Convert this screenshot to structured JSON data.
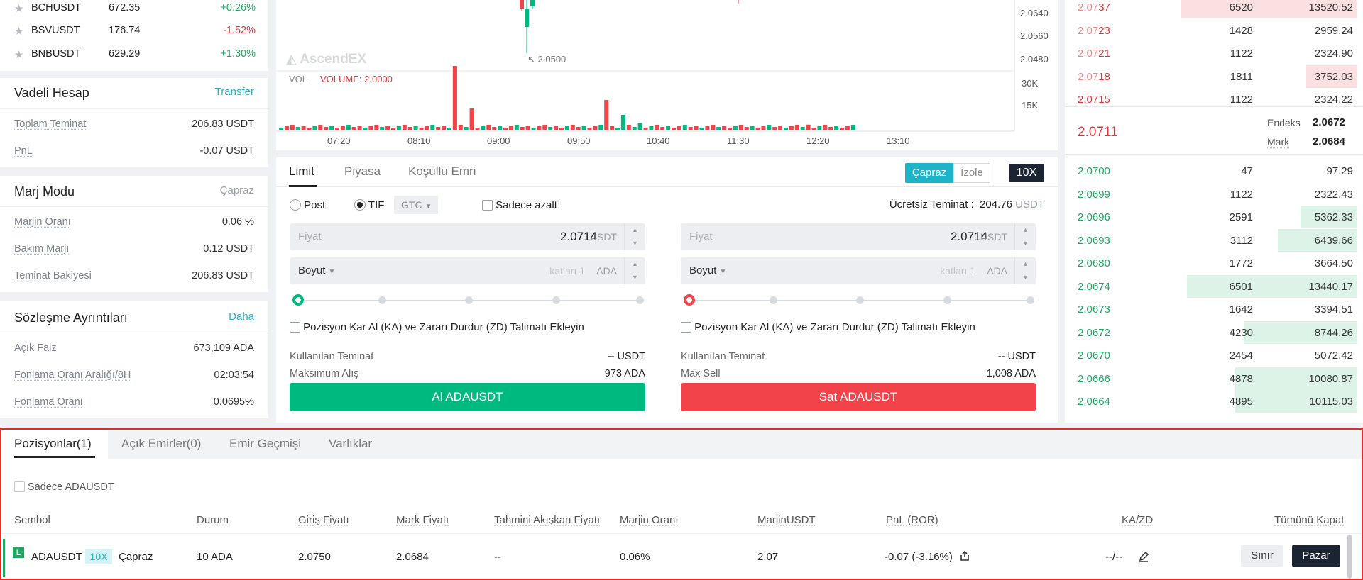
{
  "colors": {
    "green": "#1ea862",
    "red": "#e0353b",
    "teal": "#1fb3c9",
    "buy_button": "#00b97f",
    "sell_button": "#f3434a",
    "panel_border": "#e22a2a"
  },
  "tickers": [
    {
      "symbol": "BCHUSDT",
      "price": "672.35",
      "change": "+0.26%",
      "dir": "up"
    },
    {
      "symbol": "BSVUSDT",
      "price": "176.74",
      "change": "-1.52%",
      "dir": "down"
    },
    {
      "symbol": "BNBUSDT",
      "price": "629.29",
      "change": "+1.30%",
      "dir": "up"
    }
  ],
  "futures_account": {
    "title": "Vadeli Hesap",
    "action": "Transfer",
    "rows": [
      {
        "label": "Toplam Teminat",
        "value": "206.83 USDT"
      },
      {
        "label": "PnL",
        "value": "-0.07 USDT"
      }
    ]
  },
  "margin_mode": {
    "title": "Marj Modu",
    "value": "Çapraz",
    "rows": [
      {
        "label": "Marjin Oranı",
        "value": "0.06 %"
      },
      {
        "label": "Bakım Marjı",
        "value": "0.12 USDT"
      },
      {
        "label": "Teminat Bakiyesi",
        "value": "206.83 USDT"
      }
    ]
  },
  "contract": {
    "title": "Sözleşme Ayrıntıları",
    "action": "Daha",
    "rows": [
      {
        "label": "Açık Faiz",
        "value": "673,109 ADA"
      },
      {
        "label": "Fonlama Oranı Aralığı/8H",
        "value": "02:03:54"
      },
      {
        "label": "Fonlama Oranı",
        "value": "0.0695%"
      }
    ]
  },
  "chart": {
    "price_ticks": [
      "2.0640",
      "2.0560",
      "2.0480"
    ],
    "low_label": "2.0500",
    "watermark": "AscendEX",
    "vol_label": "VOL",
    "volume_label": "VOLUME: 2.0000",
    "vol_ticks": [
      "30K",
      "15K"
    ],
    "time_ticks": [
      "07:20",
      "08:10",
      "09:00",
      "09:50",
      "10:40",
      "11:30",
      "12:20",
      "13:10"
    ]
  },
  "order_form": {
    "tabs": [
      "Limit",
      "Piyasa",
      "Koşullu Emri"
    ],
    "mode_cross": "Çapraz",
    "mode_isolated": "İzole",
    "leverage": "10X",
    "post": "Post",
    "tif": "TIF",
    "tif_value": "GTC",
    "reduce_only": "Sadece azalt",
    "free_margin_label": "Ücretsiz Teminat :",
    "free_margin_value": "204.76",
    "free_margin_unit": "USDT",
    "price_label": "Fiyat",
    "price_value": "2.0714",
    "price_unit": "USDT",
    "size_label": "Boyut",
    "size_placeholder": "katları 1",
    "size_unit": "ADA",
    "tpsl": "Pozisyon Kar Al (KA) ve Zararı Durdur (ZD) Talimatı Ekleyin",
    "buy": {
      "used_label": "Kullanılan Teminat",
      "used_value": "-- USDT",
      "max_label": "Maksimum Alış",
      "max_value": "973 ADA",
      "button": "Al ADAUSDT"
    },
    "sell": {
      "used_label": "Kullanılan Teminat",
      "used_value": "-- USDT",
      "max_label": "Max Sell",
      "max_value": "1,008 ADA",
      "button": "Sat ADAUSDT"
    }
  },
  "orderbook": {
    "asks": [
      {
        "pa": "2.07",
        "pb": "37",
        "qty": "6520",
        "total": "13520.52",
        "depth": 0.62
      },
      {
        "pa": "2.07",
        "pb": "23",
        "qty": "1428",
        "total": "2959.24",
        "depth": 0.0
      },
      {
        "pa": "2.07",
        "pb": "21",
        "qty": "1122",
        "total": "2324.90",
        "depth": 0.0
      },
      {
        "pa": "2.07",
        "pb": "18",
        "qty": "1811",
        "total": "3752.03",
        "depth": 0.18
      },
      {
        "pa": "2.0715",
        "pb": "",
        "qty": "1122",
        "total": "2324.22",
        "depth": 0.0
      }
    ],
    "last_price": "2.0711",
    "index_label": "Endeks",
    "index_value": "2.0672",
    "mark_label": "Mark",
    "mark_value": "2.0684",
    "bids": [
      {
        "pa": "2.0700",
        "pb": "",
        "qty": "47",
        "total": "97.29",
        "depth": 0.0
      },
      {
        "pa": "2.0699",
        "pb": "",
        "qty": "1122",
        "total": "2322.43",
        "depth": 0.0
      },
      {
        "pa": "2.06",
        "pb": "96",
        "qty": "2591",
        "total": "5362.33",
        "depth": 0.2
      },
      {
        "pa": "2.06",
        "pb": "93",
        "qty": "3112",
        "total": "6439.66",
        "depth": 0.28
      },
      {
        "pa": "2.0680",
        "pb": "",
        "qty": "1772",
        "total": "3664.50",
        "depth": 0.0
      },
      {
        "pa": "2.06",
        "pb": "74",
        "qty": "6501",
        "total": "13440.17",
        "depth": 0.6
      },
      {
        "pa": "2.06",
        "pb": "73",
        "qty": "1642",
        "total": "3394.51",
        "depth": 0.0
      },
      {
        "pa": "2.06",
        "pb": "72",
        "qty": "4230",
        "total": "8744.26",
        "depth": 0.4
      },
      {
        "pa": "2.06",
        "pb": "70",
        "qty": "2454",
        "total": "5072.42",
        "depth": 0.0
      },
      {
        "pa": "2.06",
        "pb": "66",
        "qty": "4878",
        "total": "10080.87",
        "depth": 0.43
      },
      {
        "pa": "2.06",
        "pb": "64",
        "qty": "4895",
        "total": "10115.03",
        "depth": 0.43
      }
    ]
  },
  "positions": {
    "tabs": [
      "Pozisyonlar(1)",
      "Açık Emirler(0)",
      "Emir Geçmişi",
      "Varlıklar"
    ],
    "only_symbol": "Sadece ADAUSDT",
    "columns": {
      "symbol": "Sembol",
      "status": "Durum",
      "entry": "Giriş Fiyatı",
      "mark": "Mark Fiyatı",
      "liq": "Tahmini Akışkan Fiyatı",
      "margin_ratio": "Marjin Oranı",
      "margin": "MarjinUSDT",
      "pnl": "PnL (ROR)",
      "tpsl": "KA/ZD",
      "close_all": "Tümünü Kapat"
    },
    "row": {
      "side_badge": "L",
      "symbol": "ADAUSDT",
      "leverage": "10X",
      "mode": "Çapraz",
      "status": "10 ADA",
      "entry": "2.0750",
      "mark": "2.0684",
      "liq": "--",
      "margin_ratio": "0.06%",
      "margin": "2.07",
      "pnl": "-0.07 (-3.16%)",
      "tpsl": "--/--",
      "limit_button": "Sınır",
      "market_button": "Pazar"
    }
  }
}
